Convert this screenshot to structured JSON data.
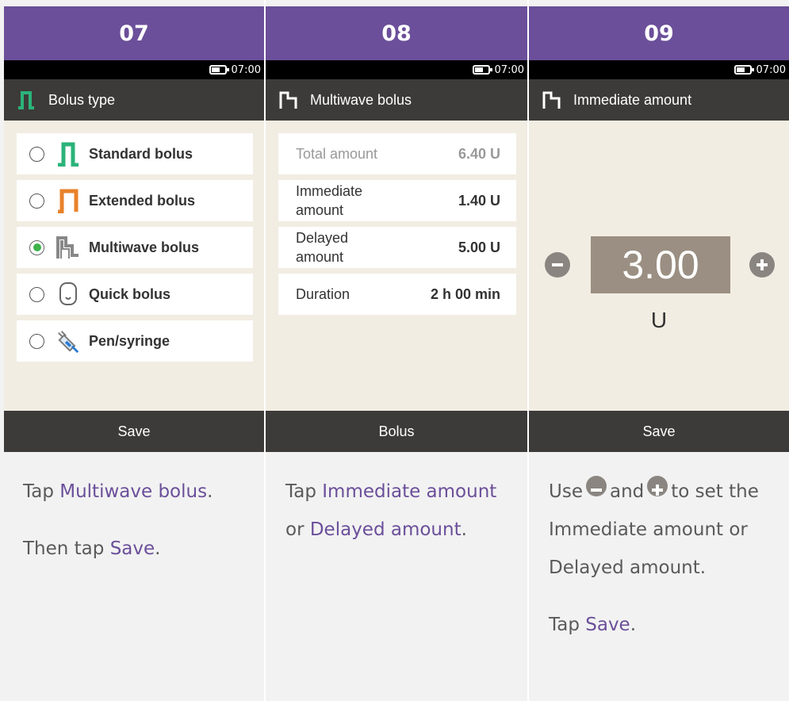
{
  "status_time": "07:00",
  "steps": [
    {
      "number": "07",
      "title": "Bolus type",
      "bottom_label": "Save",
      "options": [
        {
          "label": "Standard bolus",
          "icon": "standard-bolus-icon",
          "selected": false
        },
        {
          "label": "Extended bolus",
          "icon": "extended-bolus-icon",
          "selected": false
        },
        {
          "label": "Multiwave bolus",
          "icon": "multiwave-bolus-icon",
          "selected": true
        },
        {
          "label": "Quick bolus",
          "icon": "quick-bolus-icon",
          "selected": false
        },
        {
          "label": "Pen/syringe",
          "icon": "syringe-icon",
          "selected": false
        }
      ],
      "instr": {
        "tap": "Tap",
        "link1": "Multiwave bolus",
        "dot1": ".",
        "then": "Then tap",
        "link2": "Save",
        "dot2": "."
      }
    },
    {
      "number": "08",
      "title": "Multiwave bolus",
      "bottom_label": "Bolus",
      "rows": [
        {
          "label": "Total amount",
          "value": "6.40 U",
          "disabled": true
        },
        {
          "label": "Immediate amount",
          "value": "1.40 U",
          "disabled": false
        },
        {
          "label": "Delayed amount",
          "value": "5.00 U",
          "disabled": false
        },
        {
          "label": "Duration",
          "value": "2 h 00 min",
          "disabled": false
        }
      ],
      "instr": {
        "tap": "Tap",
        "link1": "Immediate amount",
        "or": "or",
        "link2": "Delayed amount",
        "dot": "."
      }
    },
    {
      "number": "09",
      "title": "Immediate amount",
      "bottom_label": "Save",
      "value": "3.00",
      "unit": "U",
      "instr": {
        "use": "Use",
        "and": "and",
        "to": "to",
        "rest": "set the Immediate amount or Delayed amount.",
        "tap": "Tap",
        "link": "Save",
        "dot": "."
      }
    }
  ],
  "colors": {
    "accent": "#6b4f9a",
    "green": "#2bb37a",
    "orange": "#e8822a",
    "bar": "#3c3b3a",
    "screen_bg": "#f2ede2"
  }
}
